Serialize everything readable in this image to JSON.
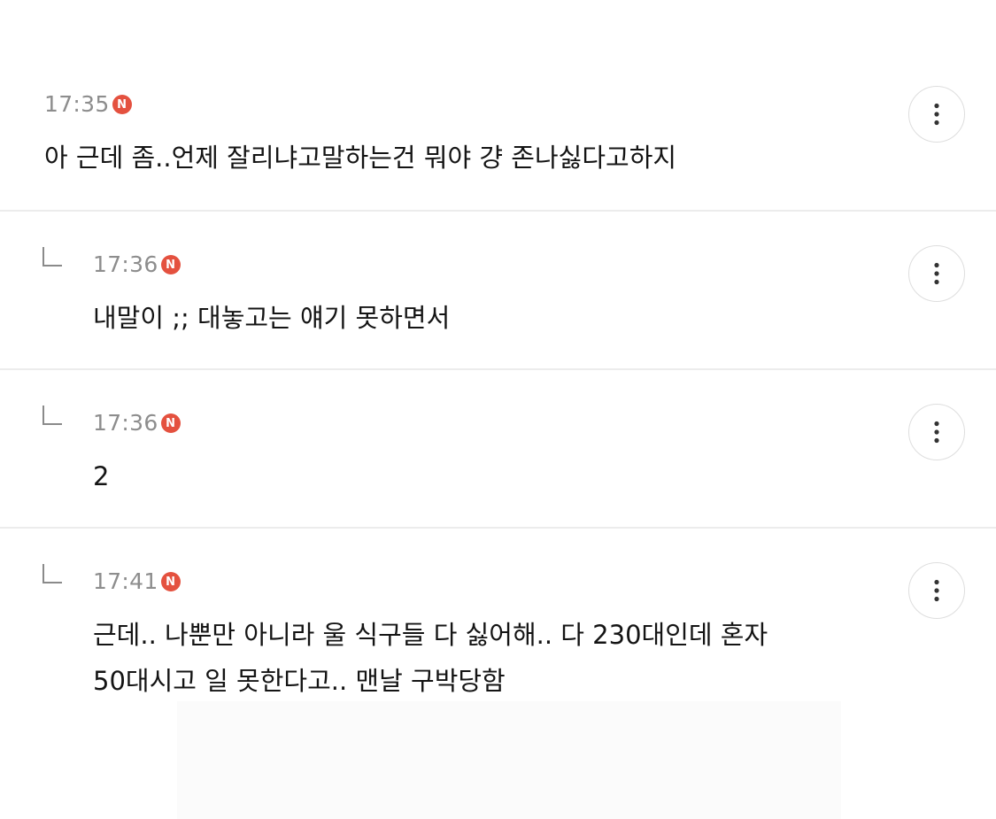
{
  "comments": [
    {
      "time": "17:35",
      "badge": "N",
      "text": "아 근데 좀..언제 잘리냐고말하는건 뭐야 걍 존나싫다고하지",
      "more_icon": "vertical-ellipsis-icon"
    },
    {
      "time": "17:36",
      "badge": "N",
      "text": "내말이 ;; 대놓고는 얘기 못하면서",
      "more_icon": "vertical-ellipsis-icon"
    },
    {
      "time": "17:36",
      "badge": "N",
      "text": "2",
      "more_icon": "vertical-ellipsis-icon"
    },
    {
      "time": "17:41",
      "badge": "N",
      "text": "근데.. 나뿐만 아니라 울 식구들 다 싫어해.. 다 230대인데 혼자\n50대시고 일 못한다고.. 맨날 구박당함",
      "more_icon": "vertical-ellipsis-icon"
    }
  ],
  "colors": {
    "new_badge": "#e4513f",
    "timestamp": "#8d8d8d",
    "divider": "#ececec"
  }
}
